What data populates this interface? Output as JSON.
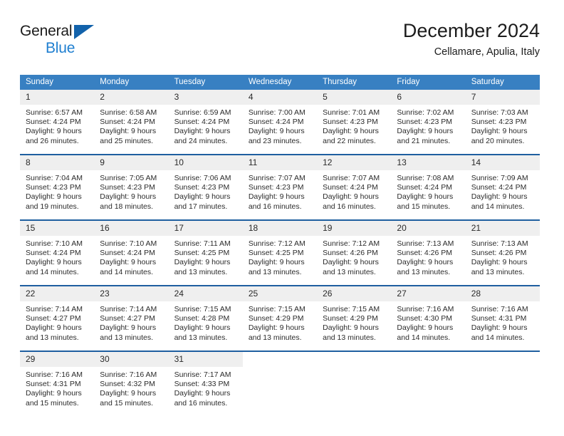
{
  "brand": {
    "name_part1": "General",
    "name_part2": "Blue",
    "triangle_color": "#1262ab",
    "blue_color": "#1f7fd0"
  },
  "header": {
    "title": "December 2024",
    "subtitle": "Cellamare, Apulia, Italy"
  },
  "theme": {
    "header_blue": "#3880c2",
    "separator_blue": "#1f5fa0",
    "date_band": "#efefef"
  },
  "weekdays": [
    "Sunday",
    "Monday",
    "Tuesday",
    "Wednesday",
    "Thursday",
    "Friday",
    "Saturday"
  ],
  "weeks": [
    [
      {
        "day": "1",
        "sunrise": "Sunrise: 6:57 AM",
        "sunset": "Sunset: 4:24 PM",
        "daylight1": "Daylight: 9 hours",
        "daylight2": "and 26 minutes."
      },
      {
        "day": "2",
        "sunrise": "Sunrise: 6:58 AM",
        "sunset": "Sunset: 4:24 PM",
        "daylight1": "Daylight: 9 hours",
        "daylight2": "and 25 minutes."
      },
      {
        "day": "3",
        "sunrise": "Sunrise: 6:59 AM",
        "sunset": "Sunset: 4:24 PM",
        "daylight1": "Daylight: 9 hours",
        "daylight2": "and 24 minutes."
      },
      {
        "day": "4",
        "sunrise": "Sunrise: 7:00 AM",
        "sunset": "Sunset: 4:24 PM",
        "daylight1": "Daylight: 9 hours",
        "daylight2": "and 23 minutes."
      },
      {
        "day": "5",
        "sunrise": "Sunrise: 7:01 AM",
        "sunset": "Sunset: 4:23 PM",
        "daylight1": "Daylight: 9 hours",
        "daylight2": "and 22 minutes."
      },
      {
        "day": "6",
        "sunrise": "Sunrise: 7:02 AM",
        "sunset": "Sunset: 4:23 PM",
        "daylight1": "Daylight: 9 hours",
        "daylight2": "and 21 minutes."
      },
      {
        "day": "7",
        "sunrise": "Sunrise: 7:03 AM",
        "sunset": "Sunset: 4:23 PM",
        "daylight1": "Daylight: 9 hours",
        "daylight2": "and 20 minutes."
      }
    ],
    [
      {
        "day": "8",
        "sunrise": "Sunrise: 7:04 AM",
        "sunset": "Sunset: 4:23 PM",
        "daylight1": "Daylight: 9 hours",
        "daylight2": "and 19 minutes."
      },
      {
        "day": "9",
        "sunrise": "Sunrise: 7:05 AM",
        "sunset": "Sunset: 4:23 PM",
        "daylight1": "Daylight: 9 hours",
        "daylight2": "and 18 minutes."
      },
      {
        "day": "10",
        "sunrise": "Sunrise: 7:06 AM",
        "sunset": "Sunset: 4:23 PM",
        "daylight1": "Daylight: 9 hours",
        "daylight2": "and 17 minutes."
      },
      {
        "day": "11",
        "sunrise": "Sunrise: 7:07 AM",
        "sunset": "Sunset: 4:23 PM",
        "daylight1": "Daylight: 9 hours",
        "daylight2": "and 16 minutes."
      },
      {
        "day": "12",
        "sunrise": "Sunrise: 7:07 AM",
        "sunset": "Sunset: 4:24 PM",
        "daylight1": "Daylight: 9 hours",
        "daylight2": "and 16 minutes."
      },
      {
        "day": "13",
        "sunrise": "Sunrise: 7:08 AM",
        "sunset": "Sunset: 4:24 PM",
        "daylight1": "Daylight: 9 hours",
        "daylight2": "and 15 minutes."
      },
      {
        "day": "14",
        "sunrise": "Sunrise: 7:09 AM",
        "sunset": "Sunset: 4:24 PM",
        "daylight1": "Daylight: 9 hours",
        "daylight2": "and 14 minutes."
      }
    ],
    [
      {
        "day": "15",
        "sunrise": "Sunrise: 7:10 AM",
        "sunset": "Sunset: 4:24 PM",
        "daylight1": "Daylight: 9 hours",
        "daylight2": "and 14 minutes."
      },
      {
        "day": "16",
        "sunrise": "Sunrise: 7:10 AM",
        "sunset": "Sunset: 4:24 PM",
        "daylight1": "Daylight: 9 hours",
        "daylight2": "and 14 minutes."
      },
      {
        "day": "17",
        "sunrise": "Sunrise: 7:11 AM",
        "sunset": "Sunset: 4:25 PM",
        "daylight1": "Daylight: 9 hours",
        "daylight2": "and 13 minutes."
      },
      {
        "day": "18",
        "sunrise": "Sunrise: 7:12 AM",
        "sunset": "Sunset: 4:25 PM",
        "daylight1": "Daylight: 9 hours",
        "daylight2": "and 13 minutes."
      },
      {
        "day": "19",
        "sunrise": "Sunrise: 7:12 AM",
        "sunset": "Sunset: 4:26 PM",
        "daylight1": "Daylight: 9 hours",
        "daylight2": "and 13 minutes."
      },
      {
        "day": "20",
        "sunrise": "Sunrise: 7:13 AM",
        "sunset": "Sunset: 4:26 PM",
        "daylight1": "Daylight: 9 hours",
        "daylight2": "and 13 minutes."
      },
      {
        "day": "21",
        "sunrise": "Sunrise: 7:13 AM",
        "sunset": "Sunset: 4:26 PM",
        "daylight1": "Daylight: 9 hours",
        "daylight2": "and 13 minutes."
      }
    ],
    [
      {
        "day": "22",
        "sunrise": "Sunrise: 7:14 AM",
        "sunset": "Sunset: 4:27 PM",
        "daylight1": "Daylight: 9 hours",
        "daylight2": "and 13 minutes."
      },
      {
        "day": "23",
        "sunrise": "Sunrise: 7:14 AM",
        "sunset": "Sunset: 4:27 PM",
        "daylight1": "Daylight: 9 hours",
        "daylight2": "and 13 minutes."
      },
      {
        "day": "24",
        "sunrise": "Sunrise: 7:15 AM",
        "sunset": "Sunset: 4:28 PM",
        "daylight1": "Daylight: 9 hours",
        "daylight2": "and 13 minutes."
      },
      {
        "day": "25",
        "sunrise": "Sunrise: 7:15 AM",
        "sunset": "Sunset: 4:29 PM",
        "daylight1": "Daylight: 9 hours",
        "daylight2": "and 13 minutes."
      },
      {
        "day": "26",
        "sunrise": "Sunrise: 7:15 AM",
        "sunset": "Sunset: 4:29 PM",
        "daylight1": "Daylight: 9 hours",
        "daylight2": "and 13 minutes."
      },
      {
        "day": "27",
        "sunrise": "Sunrise: 7:16 AM",
        "sunset": "Sunset: 4:30 PM",
        "daylight1": "Daylight: 9 hours",
        "daylight2": "and 14 minutes."
      },
      {
        "day": "28",
        "sunrise": "Sunrise: 7:16 AM",
        "sunset": "Sunset: 4:31 PM",
        "daylight1": "Daylight: 9 hours",
        "daylight2": "and 14 minutes."
      }
    ],
    [
      {
        "day": "29",
        "sunrise": "Sunrise: 7:16 AM",
        "sunset": "Sunset: 4:31 PM",
        "daylight1": "Daylight: 9 hours",
        "daylight2": "and 15 minutes."
      },
      {
        "day": "30",
        "sunrise": "Sunrise: 7:16 AM",
        "sunset": "Sunset: 4:32 PM",
        "daylight1": "Daylight: 9 hours",
        "daylight2": "and 15 minutes."
      },
      {
        "day": "31",
        "sunrise": "Sunrise: 7:17 AM",
        "sunset": "Sunset: 4:33 PM",
        "daylight1": "Daylight: 9 hours",
        "daylight2": "and 16 minutes."
      },
      {
        "day": "",
        "sunrise": "",
        "sunset": "",
        "daylight1": "",
        "daylight2": ""
      },
      {
        "day": "",
        "sunrise": "",
        "sunset": "",
        "daylight1": "",
        "daylight2": ""
      },
      {
        "day": "",
        "sunrise": "",
        "sunset": "",
        "daylight1": "",
        "daylight2": ""
      },
      {
        "day": "",
        "sunrise": "",
        "sunset": "",
        "daylight1": "",
        "daylight2": ""
      }
    ]
  ]
}
